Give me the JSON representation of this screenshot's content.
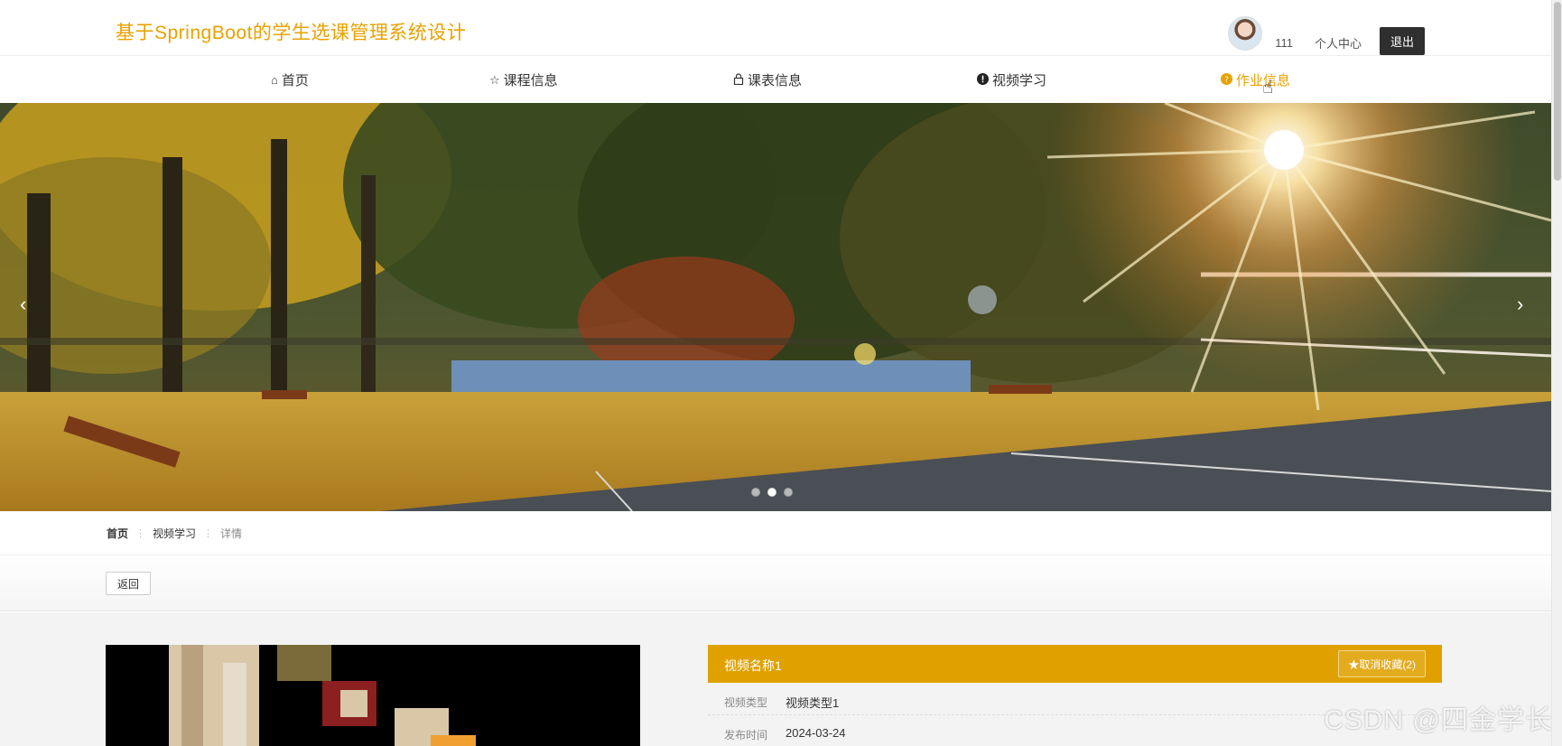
{
  "header": {
    "site_title": "基于SpringBoot的学生选课管理系统设计",
    "username": "111",
    "personal_center": "个人中心",
    "logout": "退出"
  },
  "nav": {
    "items": [
      {
        "label": "首页",
        "icon": "home-icon"
      },
      {
        "label": "课程信息",
        "icon": "star-icon"
      },
      {
        "label": "课表信息",
        "icon": "lock-icon"
      },
      {
        "label": "视频学习",
        "icon": "exclamation-circle-icon"
      },
      {
        "label": "作业信息",
        "icon": "question-circle-icon"
      }
    ],
    "active": "作业信息"
  },
  "banner": {
    "prev": "‹",
    "next": "›",
    "active_slide": 2,
    "slide_count": 3
  },
  "breadcrumb": {
    "home": "首页",
    "section": "视频学习",
    "current": "详情"
  },
  "back_button": "返回",
  "detail": {
    "title": "视频名称1",
    "favorite_button": "★取消收藏(2)",
    "fields": [
      {
        "label": "视频类型",
        "value": "视频类型1"
      },
      {
        "label": "发布时间",
        "value": "2024-03-24"
      }
    ]
  },
  "watermark": "CSDN @四金学长",
  "colors": {
    "accent": "#e8a200",
    "detail_header": "#e0a100",
    "logout_bg": "#2f2f2f"
  }
}
